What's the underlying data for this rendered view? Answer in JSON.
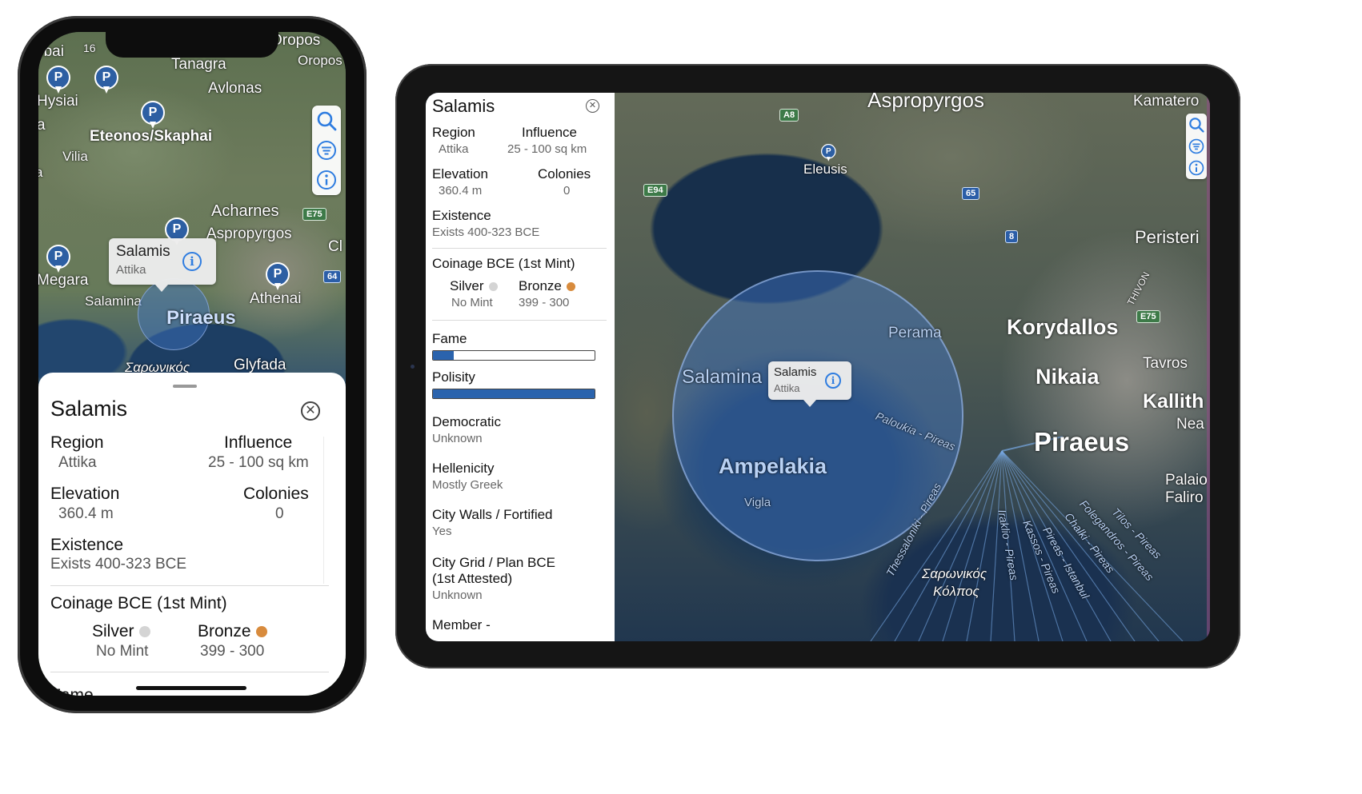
{
  "phone": {
    "status_time": "16",
    "map_labels": {
      "oropos_a": "Oropos",
      "oropos_b": "Oropos",
      "thebai": "ebai",
      "tanagra": "Tanagra",
      "avlonas": "Avlonas",
      "hysiai": "Hysiai",
      "edge_a": "a",
      "eteonos": "Eteonos/Skaphai",
      "vilia": "Vilia",
      "edge_a2": "a",
      "acharnes": "Acharnes",
      "aspropyrgos": "Aspropyrgos",
      "edge_cl": "Cl",
      "megara": "Megara",
      "salamina": "Salamina",
      "athenai": "Athenai",
      "piraeus": "Piraeus",
      "saronikos": "Σαρωνικός",
      "glyfada": "Glyfada"
    },
    "road_badges": {
      "e75": "E75",
      "r64": "64"
    },
    "callout": {
      "name": "Salamis",
      "region": "Attika"
    },
    "sheet": {
      "title": "Salamis",
      "region_label": "Region",
      "region_value": "Attika",
      "influence_label": "Influence",
      "influence_value": "25 - 100 sq km",
      "elevation_label": "Elevation",
      "elevation_value": "360.4 m",
      "colonies_label": "Colonies",
      "colonies_value": "0",
      "existence_label": "Existence",
      "existence_value": "Exists 400-323 BCE",
      "coinage_label": "Coinage BCE (1st Mint)",
      "silver_label": "Silver",
      "silver_value": "No Mint",
      "bronze_label": "Bronze",
      "bronze_value": "399 - 300",
      "next_label": "Fame"
    }
  },
  "tablet": {
    "panel": {
      "title": "Salamis",
      "region_label": "Region",
      "region_value": "Attika",
      "influence_label": "Influence",
      "influence_value": "25 - 100 sq km",
      "elevation_label": "Elevation",
      "elevation_value": "360.4 m",
      "colonies_label": "Colonies",
      "colonies_value": "0",
      "existence_label": "Existence",
      "existence_value": "Exists 400-323 BCE",
      "coinage_label": "Coinage BCE (1st Mint)",
      "silver_label": "Silver",
      "silver_value": "No Mint",
      "bronze_label": "Bronze",
      "bronze_value": "399 - 300",
      "fame_label": "Fame",
      "fame_level": 0.13,
      "polisity_label": "Polisity",
      "polisity_level": 1.0,
      "democratic_label": "Democratic",
      "democratic_value": "Unknown",
      "hellenicity_label": "Hellenicity",
      "hellenicity_value": "Mostly Greek",
      "walls_label": "City Walls / Fortified",
      "walls_value": "Yes",
      "grid_label_1": "City  Grid / Plan BCE",
      "grid_label_2": "(1st Attested)",
      "grid_value": "Unknown",
      "member_label": "Member -"
    },
    "map_labels": {
      "aspropyrgos": "Aspropyrgos",
      "kamatero": "Kamatero",
      "eleusis": "Eleusis",
      "peristeri": "Peristeri",
      "thivon": "THIVON",
      "perama": "Perama",
      "korydallos": "Korydallos",
      "salamina": "Salamina",
      "tavros": "Tavros",
      "nikaia": "Nikaia",
      "kallith": "Kallith",
      "nea": "Nea",
      "paloukia": "Paloukia - Pireas",
      "piraeus": "Piraeus",
      "ampelakia": "Ampelakia",
      "palaio": "Palaio",
      "faliro": "Faliro",
      "vigla": "Vigla",
      "thessaloniki": "Thessaloniki - Pireas",
      "iraklio": "Iraklio - Pireas",
      "kassos": "Kassos - Pireas",
      "pireas_istanbul": "Pireas - Istanbul",
      "chalki": "Chalki - Pireas",
      "folegandros": "Folegandros - Pireas",
      "tilos": "Tilos - Pireas",
      "saronikos_1": "Σαρωνικός",
      "saronikos_2": "Κόλπος"
    },
    "road_badges": {
      "a8": "A8",
      "e94": "E94",
      "r65": "65",
      "r8": "8",
      "e75": "E75"
    },
    "callout": {
      "name": "Salamis",
      "region": "Attika"
    }
  },
  "colors": {
    "pin_blue": "#2d5fa3",
    "bar_fill": "#2a63ad",
    "info_blue": "#2f7de0",
    "silver_dot": "#d4d4d4",
    "bronze_dot": "#d88b3d",
    "influence_circle": "rgba(64,118,200,0.45)"
  },
  "icons": [
    "search-icon",
    "list-filter-icon",
    "info-icon",
    "close-icon",
    "map-pin-icon"
  ]
}
